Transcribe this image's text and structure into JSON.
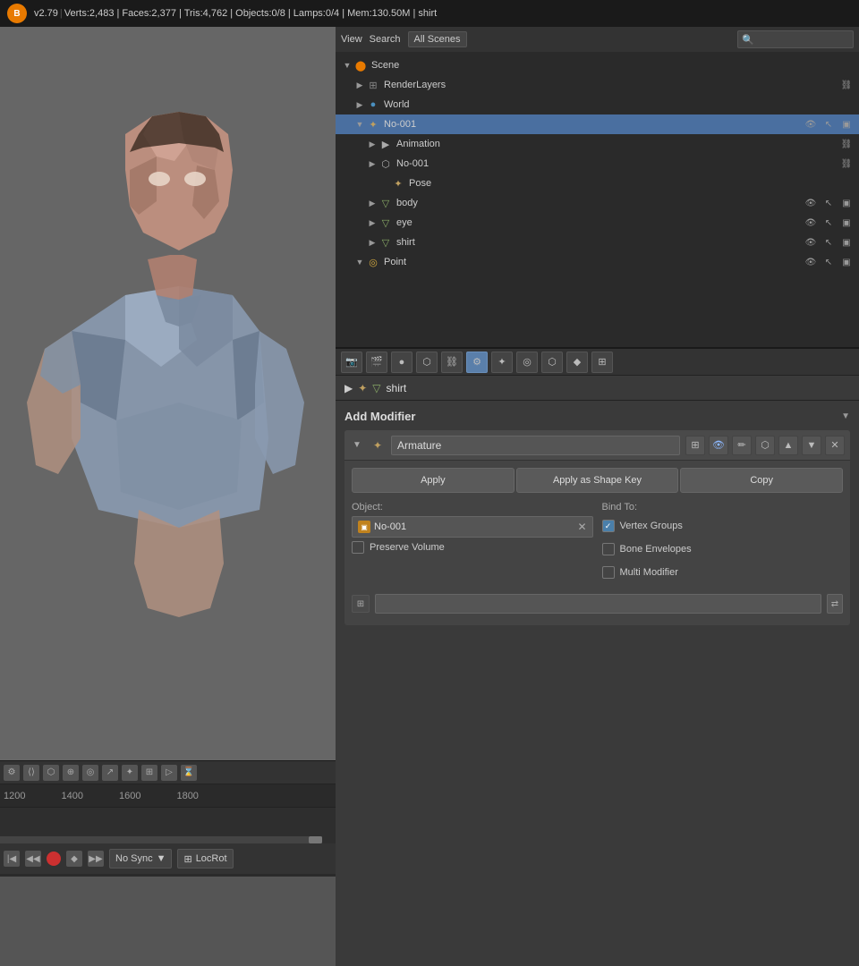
{
  "header": {
    "version": "v2.79",
    "stats": "Verts:2,483 | Faces:2,377 | Tris:4,762 | Objects:0/8 | Lamps:0/4 | Mem:130.50M | shirt"
  },
  "outliner": {
    "view_label": "View",
    "search_label": "Search",
    "all_scenes_label": "All Scenes",
    "tree": [
      {
        "id": "scene",
        "label": "Scene",
        "level": 0,
        "icon": "⬤",
        "expanded": true,
        "selected": false
      },
      {
        "id": "renderlayers",
        "label": "RenderLayers",
        "level": 1,
        "icon": "▦",
        "expanded": false,
        "selected": false
      },
      {
        "id": "world",
        "label": "World",
        "level": 1,
        "icon": "●",
        "expanded": false,
        "selected": false
      },
      {
        "id": "no001-armature",
        "label": "No-001",
        "level": 1,
        "icon": "✦",
        "expanded": true,
        "selected": true
      },
      {
        "id": "animation",
        "label": "Animation",
        "level": 2,
        "icon": "▶",
        "expanded": false,
        "selected": false
      },
      {
        "id": "no001-bone",
        "label": "No-001",
        "level": 2,
        "icon": "⬡",
        "expanded": true,
        "selected": false
      },
      {
        "id": "pose",
        "label": "Pose",
        "level": 3,
        "icon": "✦",
        "expanded": false,
        "selected": false
      },
      {
        "id": "body",
        "label": "body",
        "level": 2,
        "icon": "▽",
        "expanded": false,
        "selected": false
      },
      {
        "id": "eye",
        "label": "eye",
        "level": 2,
        "icon": "▽",
        "expanded": false,
        "selected": false
      },
      {
        "id": "shirt",
        "label": "shirt",
        "level": 2,
        "icon": "▽",
        "expanded": false,
        "selected": false
      },
      {
        "id": "point",
        "label": "Point",
        "level": 1,
        "icon": "◎",
        "expanded": false,
        "selected": false
      }
    ]
  },
  "properties_panel": {
    "breadcrumb_arrow": "▶",
    "object_name": "shirt",
    "object_icon": "▽"
  },
  "modifier_panel": {
    "add_modifier_label": "Add Modifier",
    "modifier_name": "Armature",
    "apply_label": "Apply",
    "apply_shape_key_label": "Apply as Shape Key",
    "copy_label": "Copy",
    "object_label": "Object:",
    "object_value": "No-001",
    "bind_to_label": "Bind To:",
    "preserve_volume_label": "Preserve Volume",
    "preserve_volume_checked": false,
    "vertex_groups_label": "Vertex Groups",
    "vertex_groups_checked": true,
    "bone_envelopes_label": "Bone Envelopes",
    "bone_envelopes_checked": false,
    "multi_modifier_label": "Multi Modifier",
    "multi_modifier_checked": false
  },
  "timeline": {
    "markers": [
      "1200",
      "1400",
      "1600",
      "1800"
    ],
    "no_sync_label": "No Sync",
    "locrot_label": "LocRot"
  }
}
